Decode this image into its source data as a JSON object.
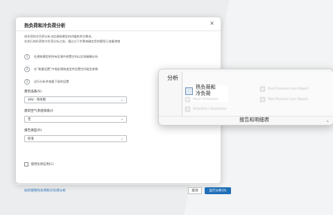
{
  "dialog": {
    "title": "热负荷和冷负荷分析",
    "close_glyph": "×",
    "intro_line1": "热负荷和冷负荷分析决定建筑模型的供暖和供冷需求。",
    "intro_line2": "在执行热负荷和冷负荷分析之前，通过以下步骤来确定您的模型已准备就绪",
    "steps": [
      {
        "num": "1",
        "text": "在建筑模型的所有区域中放置空间以实现精确分析"
      },
      {
        "num": "2",
        "text": "在“能量设置”中指定建筑类型并设置空间类型参数"
      },
      {
        "num": "3",
        "text": "运行分析并查看下面的设置"
      }
    ],
    "building_service_label": "建筑设备(S)",
    "building_service_value": "VAV - 单风管",
    "air_leakage_label": "建筑空气渗透等级(I)",
    "air_leakage_value": "无",
    "report_type_label": "报告类型(R)",
    "report_type_value": "标准",
    "use_load_credits_label": "使用负荷信用(C)",
    "help_link": "如何使用热负荷和冷负荷分析",
    "cancel_label": "取消",
    "run_label": "运行分析(R)"
  },
  "ribbon_popup": {
    "panel_title": "分析",
    "highlighted_line1": "热负荷和",
    "highlighted_line2": "冷负荷",
    "blurred_items": {
      "panel_schedule": "Panel  Schedules",
      "schedule_quantities": "Schedule / Quantities",
      "duct_pressure": "Duct Pressure  Loss Report",
      "pipe_pressure": "Pipe Pressure  Loss Report"
    },
    "footer_label": "报告和明细表",
    "launcher_glyph": "↘"
  }
}
